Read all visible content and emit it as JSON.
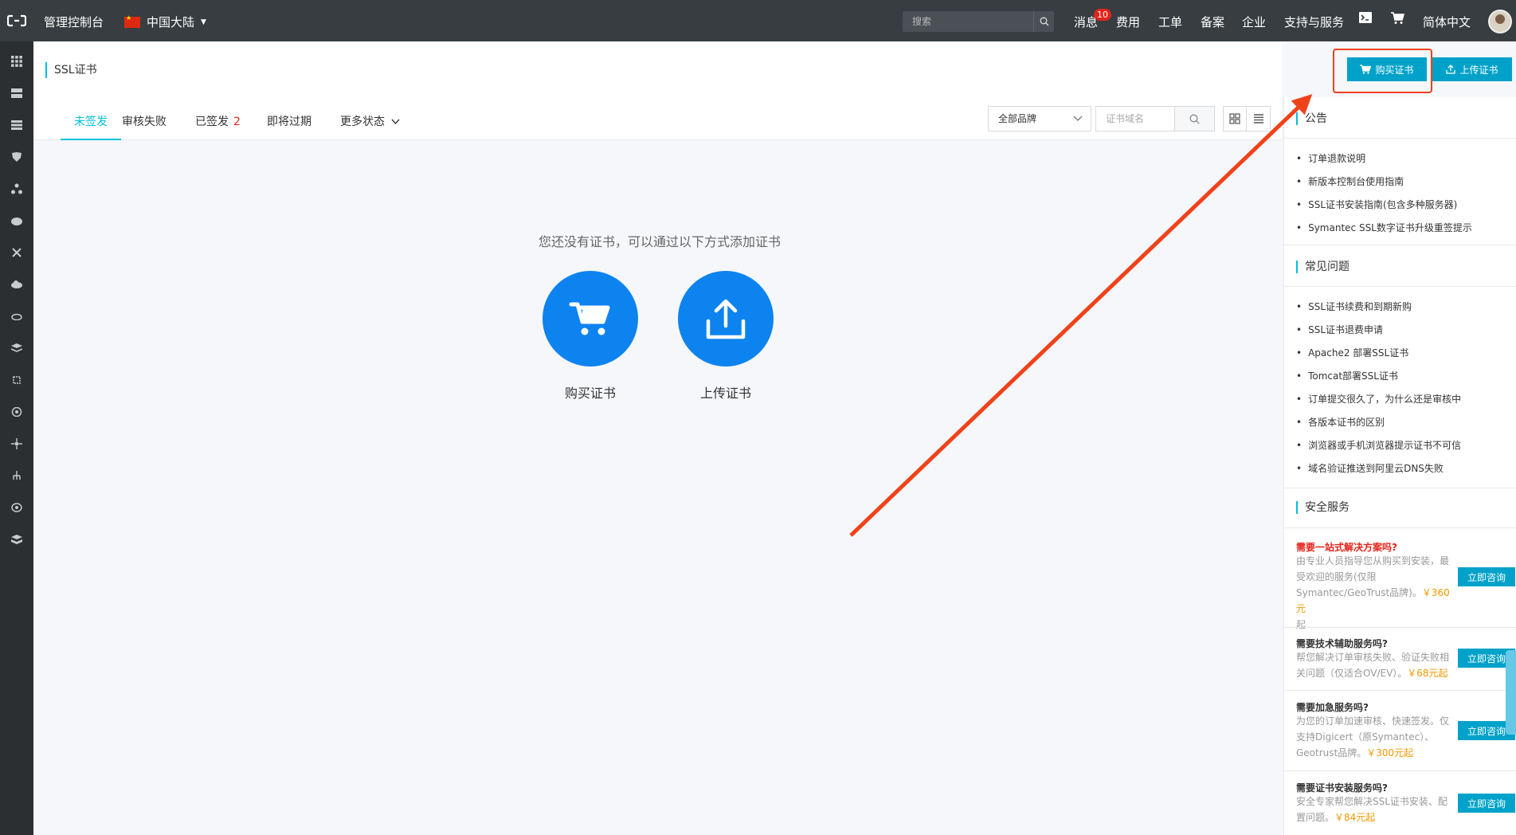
{
  "topbar": {
    "console_label": "管理控制台",
    "region_label": "中国大陆",
    "search_placeholder": "搜索",
    "messages_label": "消息",
    "messages_count": "10",
    "nav": [
      "费用",
      "工单",
      "备案",
      "企业",
      "支持与服务"
    ],
    "language_label": "简体中文"
  },
  "header": {
    "title": "SSL证书",
    "buy_button": "购买证书",
    "upload_button": "上传证书"
  },
  "tabs": [
    {
      "label": "未签发",
      "active": true
    },
    {
      "label": "审核失败"
    },
    {
      "label": "已签发",
      "count": "2"
    },
    {
      "label": "即将过期"
    },
    {
      "label": "更多状态"
    }
  ],
  "filters": {
    "brand_select": "全部品牌",
    "domain_placeholder": "证书域名"
  },
  "empty_state": {
    "message": "您还没有证书，可以通过以下方式添加证书",
    "buy_label": "购买证书",
    "upload_label": "上传证书"
  },
  "right_panel": {
    "announcements": {
      "title": "公告",
      "items": [
        "订单退款说明",
        "新版本控制台使用指南",
        "SSL证书安装指南(包含多种服务器)",
        "Symantec SSL数字证书升级重签提示"
      ]
    },
    "faq": {
      "title": "常见问题",
      "items": [
        "SSL证书续费和到期新购",
        "SSL证书退费申请",
        "Apache2 部署SSL证书",
        "Tomcat部署SSL证书",
        "订单提交很久了，为什么还是审核中",
        "各版本证书的区别",
        "浏览器或手机浏览器提示证书不可信",
        "域名验证推送到阿里云DNS失败"
      ]
    },
    "security": {
      "title": "安全服务",
      "consult_label": "立即咨询",
      "services": [
        {
          "title": "需要一站式解决方案吗?",
          "desc_lines": [
            "由专业人员指导您从购买到安装，最",
            "受欢迎的服务(仅限",
            "Symantec/GeoTrust品牌)。",
            "起"
          ],
          "price": "￥360元"
        },
        {
          "title": "需要技术辅助服务吗?",
          "desc_lines": [
            "帮您解决订单审核失败、验证失败相",
            "关问题（仅适合OV/EV）。"
          ],
          "price": "￥68元起"
        },
        {
          "title": "需要加急服务吗?",
          "desc_lines": [
            "为您的订单加速审核、快速签发。仅",
            "支持Digicert（原Symantec）、",
            "Geotrust品牌。"
          ],
          "price": "￥300元起"
        },
        {
          "title": "需要证书安装服务吗?",
          "desc_lines": [
            "安全专家帮您解决SSL证书安装、配",
            "置问题。"
          ],
          "price": "￥84元起"
        }
      ]
    }
  },
  "colors": {
    "topbar": "#373d41",
    "accent": "#00c1de",
    "button": "#00a2ca",
    "circle": "#0d83f0",
    "annotation": "#f0421a"
  }
}
